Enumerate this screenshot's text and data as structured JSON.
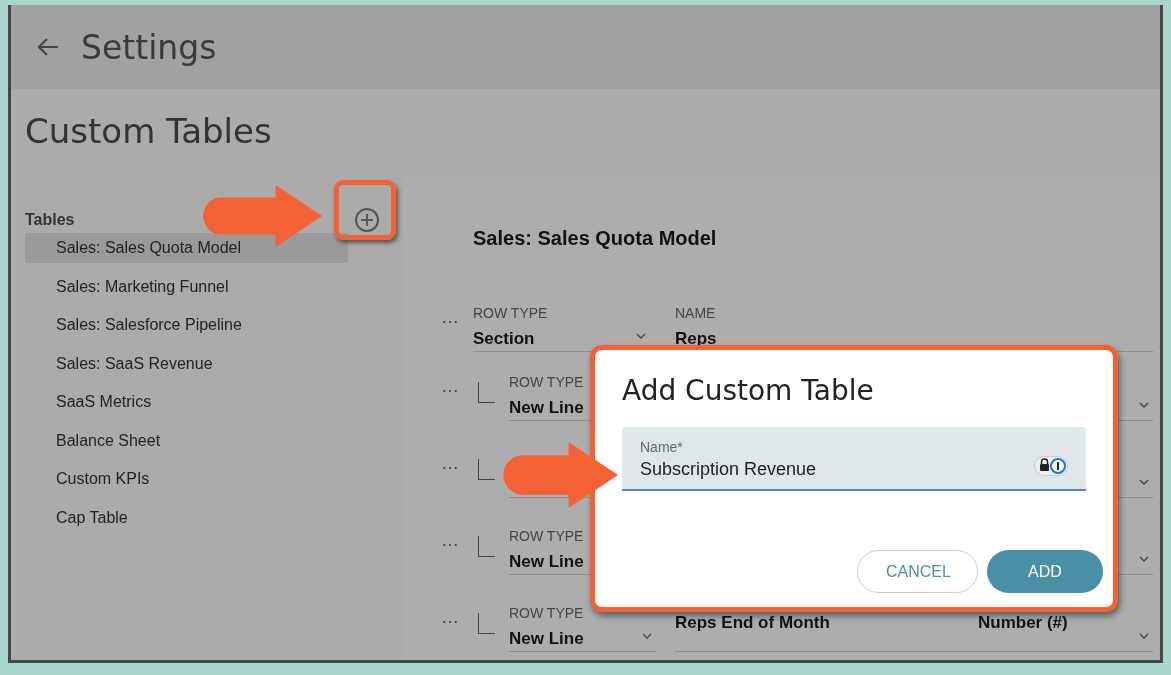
{
  "header": {
    "title": "Settings"
  },
  "page_title": "Custom Tables",
  "sidebar": {
    "heading": "Tables",
    "items": [
      {
        "label": "Sales: Sales Quota Model",
        "selected": true
      },
      {
        "label": "Sales: Marketing Funnel",
        "selected": false
      },
      {
        "label": "Sales: Salesforce Pipeline",
        "selected": false
      },
      {
        "label": "Sales: SaaS Revenue",
        "selected": false
      },
      {
        "label": "SaaS Metrics",
        "selected": false
      },
      {
        "label": "Balance Sheet",
        "selected": false
      },
      {
        "label": "Custom KPIs",
        "selected": false
      },
      {
        "label": "Cap Table",
        "selected": false
      }
    ]
  },
  "table": {
    "title": "Sales: Sales Quota Model",
    "rows": [
      {
        "kind": "section",
        "menu": "…",
        "row_type_label": "ROW TYPE",
        "row_type": "Section",
        "name_label": "NAME",
        "name": "Reps"
      },
      {
        "kind": "line",
        "menu": "…",
        "row_type_label": "ROW TYPE",
        "row_type": "New Line"
      },
      {
        "kind": "line",
        "menu": "…"
      },
      {
        "kind": "line",
        "menu": "…",
        "row_type_label": "ROW TYPE",
        "row_type": "New Line"
      },
      {
        "kind": "line",
        "menu": "…",
        "row_type_label": "ROW TYPE",
        "row_type": "New Line",
        "name": "Reps End of Month",
        "format": "Number (#)"
      }
    ]
  },
  "dialog": {
    "title": "Add Custom Table",
    "field": {
      "label": "Name*",
      "value": "Subscription Revenue"
    },
    "buttons": [
      {
        "label": "CANCEL",
        "kind": "outlined"
      },
      {
        "label": "ADD",
        "kind": "filled"
      }
    ]
  }
}
